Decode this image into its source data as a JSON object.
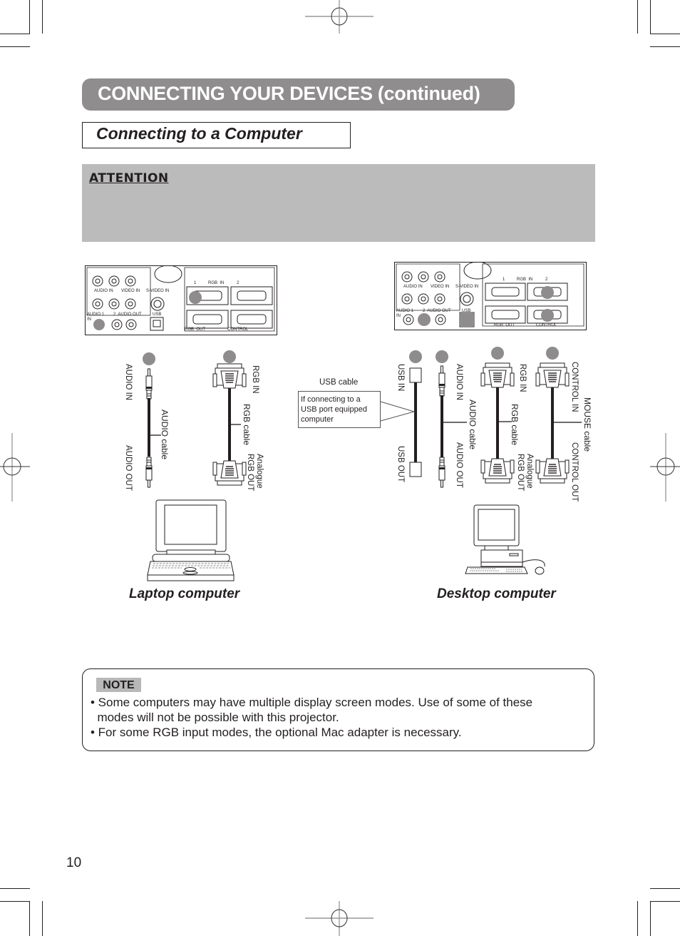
{
  "header": {
    "title": "CONNECTING YOUR DEVICES (continued)",
    "subtitle": "Connecting to a Computer"
  },
  "attention": {
    "label": "ATTENTION"
  },
  "panel": {
    "audio_in": "AUDIO IN",
    "video_in": "VIDEO IN",
    "s_video_in": "S-VIDEO IN",
    "audio_1_in": "AUDIO 1",
    "in": "IN",
    "audio_2_out": "2  AUDIO OUT",
    "usb": "USB",
    "rgb_in_1": "1",
    "rgb_in": "RGB  IN",
    "rgb_in_2": "2",
    "rgb_out": "RGB  OUT",
    "control": "CONTROL"
  },
  "laptop": {
    "caption": "Laptop computer",
    "cables": [
      {
        "top": "AUDIO IN",
        "name": "AUDIO cable",
        "bottom": "AUDIO OUT"
      },
      {
        "top": "RGB IN",
        "name": "RGB cable",
        "bottom_line1": "Analogue",
        "bottom_line2": "RGB OUT"
      }
    ]
  },
  "desktop": {
    "caption": "Desktop computer",
    "usb_cable_label": "USB cable",
    "usb_callout": "If connecting to a USB port equipped computer",
    "cables": [
      {
        "top": "USB IN",
        "bottom": "USB OUT"
      },
      {
        "top": "AUDIO IN",
        "name": "AUDIO cable",
        "bottom": "AUDIO OUT"
      },
      {
        "top": "RGB IN",
        "name": "RGB cable",
        "bottom_line1": "Analogue",
        "bottom_line2": "RGB OUT"
      },
      {
        "top": "CONTROL IN",
        "name": "MOUSE cable",
        "bottom": "CONTROL OUT"
      }
    ]
  },
  "note": {
    "label": "NOTE",
    "items": [
      "• Some computers may have multiple display screen modes. Use of some of these",
      "  modes will not be possible with this projector.",
      "• For some RGB input modes, the optional Mac adapter is necessary."
    ]
  },
  "page_number": "10",
  "colors": {
    "title_bar": "#8f8d8e",
    "attention_bg": "#bbbbbb",
    "marker_dot": "#8e8c8d",
    "note_tag_bg": "#b8b8b8"
  }
}
